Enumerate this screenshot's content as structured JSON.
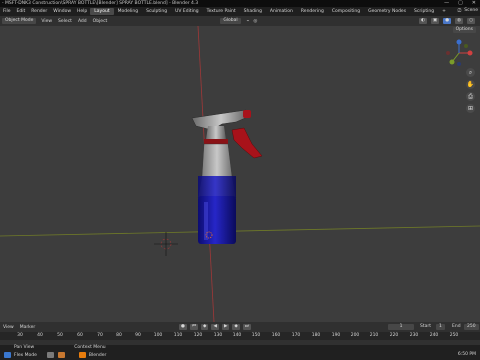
{
  "window": {
    "title": "- MSFT-DNK3 Construction\\SPRAY BOTTLE\\[Blender] SPRAY BOTTLE.blend] - Blender 4.3",
    "controls": [
      "—",
      "▢",
      "✕"
    ]
  },
  "menubar": {
    "menus": [
      "File",
      "Edit",
      "Render",
      "Window",
      "Help"
    ],
    "workspaces": [
      "Layout",
      "Modeling",
      "Sculpting",
      "UV Editing",
      "Texture Paint",
      "Shading",
      "Animation",
      "Rendering",
      "Compositing",
      "Geometry Nodes",
      "Scripting",
      "+"
    ],
    "active_workspace": "Layout",
    "scene": "Scene"
  },
  "header": {
    "items": [
      "Object Mode",
      "View",
      "Select",
      "Add",
      "Object"
    ],
    "orientation": "Global",
    "options": "Options"
  },
  "viewport": {
    "nav_icons": [
      "zoom-icon",
      "hand-icon",
      "camera-icon",
      "grid-icon"
    ]
  },
  "timeline": {
    "menus": [
      "View",
      "Marker"
    ],
    "current_frame": "1",
    "start_label": "Start",
    "start_value": "1",
    "end_label": "End",
    "end_value": "250",
    "ruler": [
      "30",
      "40",
      "50",
      "60",
      "70",
      "80",
      "90",
      "100",
      "110",
      "120",
      "130",
      "140",
      "150",
      "160",
      "170",
      "180",
      "190",
      "200",
      "210",
      "220",
      "230",
      "240",
      "250"
    ]
  },
  "status": {
    "items": [
      "Pan View",
      "Context Menu"
    ]
  },
  "taskbar": {
    "items": [
      "Flex Mode",
      "Blender"
    ],
    "time": "6:50 PM"
  },
  "colors": {
    "bottle_blue": "#1a1aa6",
    "trigger_red": "#a8121a",
    "axis_red": "#a03838",
    "axis_green": "#6f7a28",
    "active_accent": "#4a77c8"
  }
}
